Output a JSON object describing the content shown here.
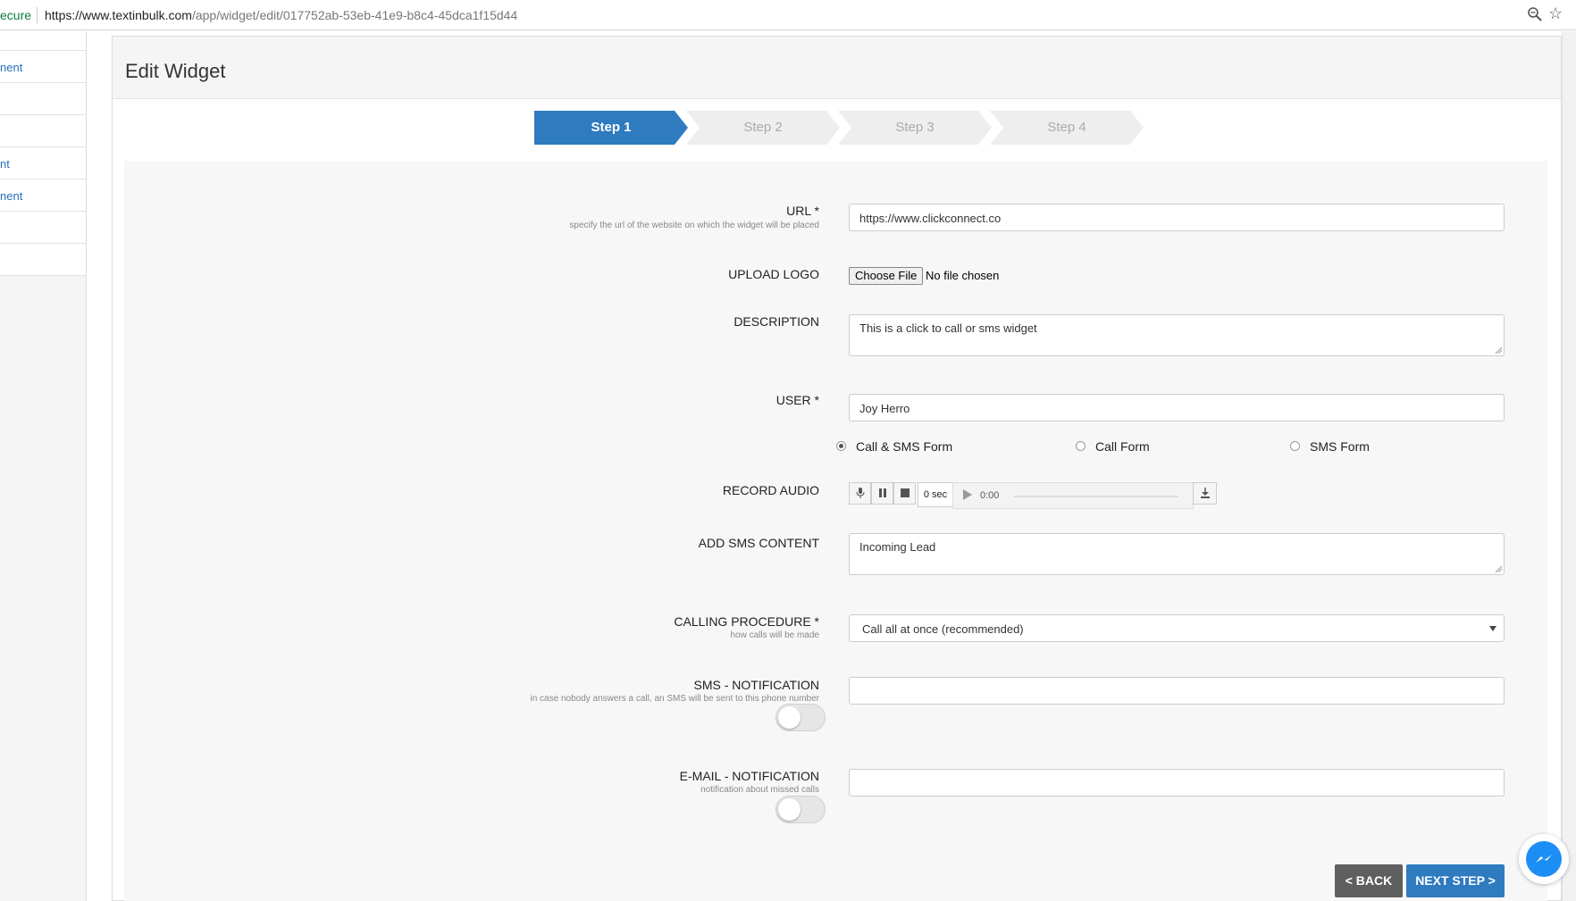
{
  "browser": {
    "secure_label": "ecure",
    "url_host": "https://www.textinbulk.com",
    "url_path": "/app/widget/edit/017752ab-53eb-41e9-b8c4-45dca1f15d44",
    "icons": [
      "zoom-icon",
      "star-icon"
    ]
  },
  "sidebar": {
    "items": [
      {
        "label": "nent"
      },
      {
        "label": ""
      },
      {
        "label": ""
      },
      {
        "label": "nt"
      },
      {
        "label": "nent"
      },
      {
        "label": ""
      },
      {
        "label": ""
      }
    ]
  },
  "page": {
    "title": "Edit Widget"
  },
  "steps": [
    {
      "label": "Step 1",
      "active": true
    },
    {
      "label": "Step 2",
      "active": false
    },
    {
      "label": "Step 3",
      "active": false
    },
    {
      "label": "Step 4",
      "active": false
    }
  ],
  "colors": {
    "accent": "#2e7bc0",
    "back_button": "#5f5f5f",
    "inactive_step": "#eeeeee"
  },
  "form": {
    "url": {
      "label": "URL *",
      "hint": "specify the url of the website on which the widget will be placed",
      "value": "https://www.clickconnect.co"
    },
    "logo": {
      "label": "UPLOAD LOGO",
      "button": "Choose File",
      "status": "No file chosen"
    },
    "description": {
      "label": "DESCRIPTION",
      "value": "This is a click to call or sms widget"
    },
    "user": {
      "label": "USER *",
      "value": "Joy Herro"
    },
    "form_type": {
      "options": [
        {
          "label": "Call & SMS Form",
          "selected": true
        },
        {
          "label": "Call Form",
          "selected": false
        },
        {
          "label": "SMS Form",
          "selected": false
        }
      ]
    },
    "record_audio": {
      "label": "RECORD AUDIO",
      "seconds": "0 sec",
      "time": "0:00",
      "icons": [
        "microphone-icon",
        "pause-icon",
        "stop-icon",
        "play-icon",
        "download-icon"
      ]
    },
    "sms_content": {
      "label": "ADD SMS CONTENT",
      "value": "Incoming Lead"
    },
    "calling_procedure": {
      "label": "CALLING PROCEDURE *",
      "hint": "how calls will be made",
      "selected": "Call all at once (recommended)"
    },
    "sms_notification": {
      "label": "SMS - NOTIFICATION",
      "hint": "in case nobody answers a call, an SMS will be sent to this phone number",
      "value": "",
      "enabled": false
    },
    "email_notification": {
      "label": "E-MAIL - NOTIFICATION",
      "hint": "notification about missed calls",
      "value": "",
      "enabled": false
    }
  },
  "actions": {
    "back": "< BACK",
    "next": "NEXT STEP >"
  }
}
